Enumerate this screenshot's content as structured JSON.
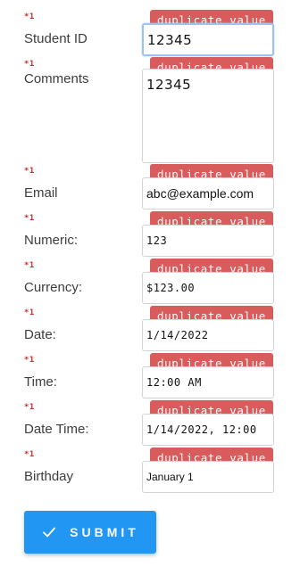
{
  "required_marker": "*1",
  "badge_text": "duplicate value",
  "fields": [
    {
      "label": "Student ID",
      "value": "12345"
    },
    {
      "label": "Comments",
      "value": "12345"
    },
    {
      "label": "Email",
      "value": "abc@example.com"
    },
    {
      "label": "Numeric:",
      "value": "123"
    },
    {
      "label": "Currency:",
      "value": "$123.00"
    },
    {
      "label": "Date:",
      "value": "1/14/2022"
    },
    {
      "label": "Time:",
      "value": "12:00 AM"
    },
    {
      "label": "Date Time:",
      "value": "1/14/2022, 12:00"
    },
    {
      "label": "Birthday",
      "value": "January 1"
    }
  ],
  "submit": {
    "label": "SUBMIT",
    "icon": "check-icon"
  },
  "colors": {
    "accent": "#2196f3",
    "badge": "#d95c5c",
    "required": "#d22b2b"
  }
}
